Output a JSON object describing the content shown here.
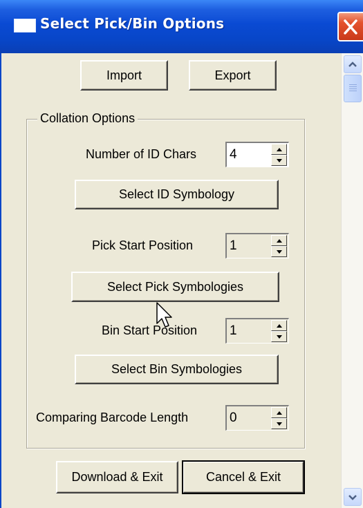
{
  "window": {
    "title": "Select Pick/Bin Options"
  },
  "toolbar": {
    "import_label": "Import",
    "export_label": "Export"
  },
  "collation": {
    "legend": "Collation Options",
    "id_chars": {
      "label": "Number of ID Chars",
      "value": "4"
    },
    "select_id_symbology": "Select ID Symbology",
    "pick_start": {
      "label": "Pick Start Position",
      "value": "1"
    },
    "select_pick_symbologies": "Select Pick Symbologies",
    "bin_start": {
      "label": "Bin Start Position",
      "value": "1"
    },
    "select_bin_symbologies": "Select Bin Symbologies",
    "compare_len": {
      "label": "Comparing Barcode Length",
      "value": "0"
    }
  },
  "footer": {
    "download_label": "Download & Exit",
    "cancel_label": "Cancel & Exit"
  },
  "colors": {
    "titlebar": "#0a4ad3",
    "face": "#ece9d8",
    "close": "#e4532e"
  }
}
